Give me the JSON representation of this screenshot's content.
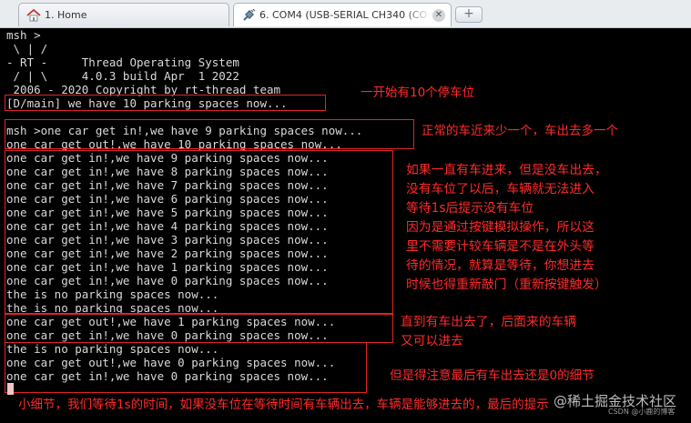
{
  "tabs": [
    {
      "label": "1. Home",
      "icon": "home-icon",
      "active": false
    },
    {
      "label": "6. COM4  (USB-SERIAL CH340 (CO",
      "icon": "serial-plug-icon",
      "active": true
    }
  ],
  "new_tab_icon": "plus-icon",
  "terminal_lines": [
    "msh >",
    " \\ | /",
    "- RT -     Thread Operating System",
    " / | \\     4.0.3 build Apr  1 2022",
    " 2006 - 2020 Copyright by rt-thread team",
    "[D/main] we have 10 parking spaces now...",
    "",
    "msh >one car get in!,we have 9 parking spaces now...",
    "one car get out!,we have 10 parking spaces now...",
    "one car get in!,we have 9 parking spaces now...",
    "one car get in!,we have 8 parking spaces now...",
    "one car get in!,we have 7 parking spaces now...",
    "one car get in!,we have 6 parking spaces now...",
    "one car get in!,we have 5 parking spaces now...",
    "one car get in!,we have 4 parking spaces now...",
    "one car get in!,we have 3 parking spaces now...",
    "one car get in!,we have 2 parking spaces now...",
    "one car get in!,we have 1 parking spaces now...",
    "one car get in!,we have 0 parking spaces now...",
    "the is no parking spaces now...",
    "the is no parking spaces now...",
    "one car get out!,we have 1 parking spaces now...",
    "one car get in!,we have 0 parking spaces now...",
    "the is no parking spaces now...",
    "one car get out!,we have 0 parking spaces now...",
    "one car get in!,we have 0 parking spaces now..."
  ],
  "annotations": [
    "一开始有10个停车位",
    "正常的车近来少一个，车出去多一个",
    "如果一直有车进来，但是没车出去，\n没有车位了以后，车辆就无法进入\n等待1s后提示没有车位\n因为是通过按键模拟操作，所以这\n里不需要计较车辆是不是在外头等\n待的情况，就算是等待，你想进去\n时候也得重新敲门（重新按键触发）",
    "直到有车出去了，后面来的车辆\n又可以进去",
    "但是得注意最后有车出去还是0的细节",
    "小细节，我们等待1s的时间，如果没车位在等待时间有车辆出去，车辆是能够进去的，最后的提示"
  ],
  "watermark": "@稀土掘金技术社区",
  "watermark_small": "CSDN @小鹿的博客",
  "colors": {
    "annotation": "#ff2a2a",
    "terminal_text": "#d9d9d9",
    "terminal_bg": "#000000",
    "tab_bar": "#e9ecef"
  }
}
